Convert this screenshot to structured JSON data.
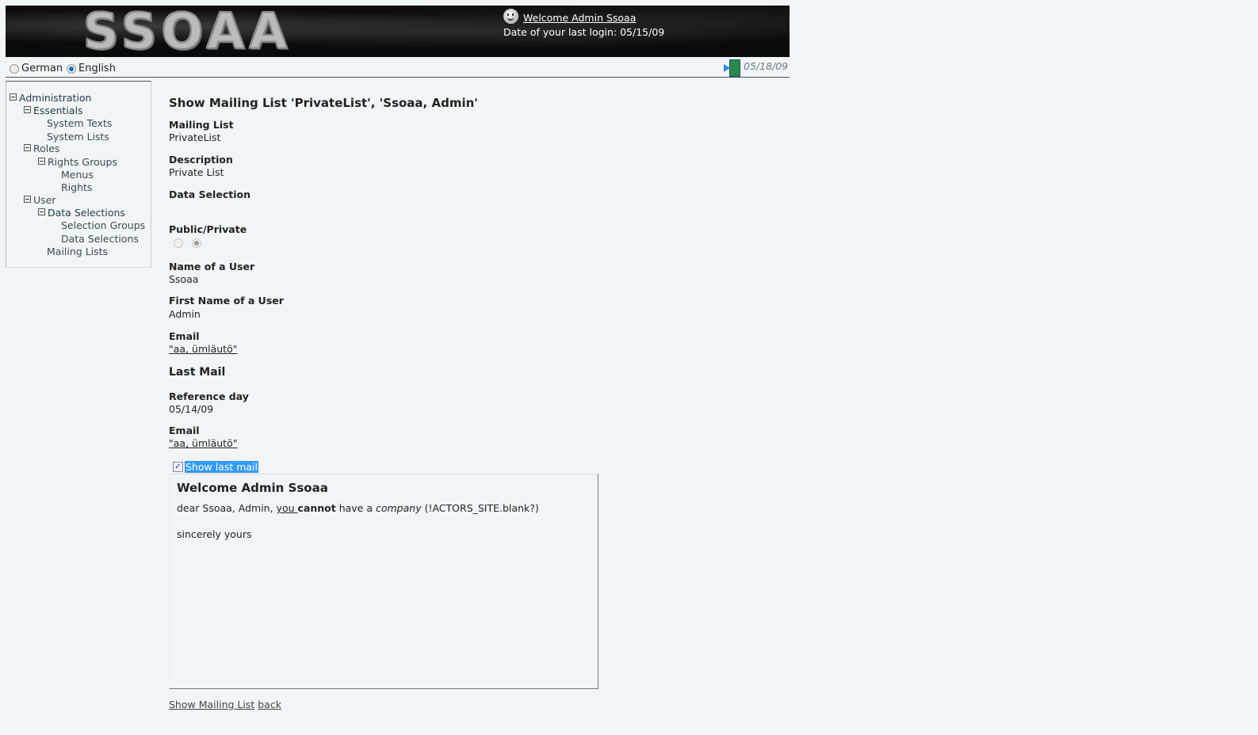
{
  "header": {
    "logo_text": "SSOAA",
    "welcome_link": "Welcome Admin Ssoaa",
    "last_login_text": "Date of your last login: 05/15/09"
  },
  "language": {
    "options": [
      {
        "label": "German",
        "selected": false
      },
      {
        "label": "English",
        "selected": true
      }
    ],
    "current_date": "05/18/09"
  },
  "sidebar": {
    "items": [
      {
        "label": "Administration",
        "expandable": true
      },
      {
        "label": "Essentials",
        "expandable": true
      },
      {
        "label": "System Texts",
        "expandable": false
      },
      {
        "label": "System Lists",
        "expandable": false
      },
      {
        "label": "Roles",
        "expandable": true
      },
      {
        "label": "Rights Groups",
        "expandable": true
      },
      {
        "label": "Menus",
        "expandable": false
      },
      {
        "label": "Rights",
        "expandable": false
      },
      {
        "label": "User",
        "expandable": true
      },
      {
        "label": "Data Selections",
        "expandable": true
      },
      {
        "label": "Selection Groups",
        "expandable": false
      },
      {
        "label": "Data Selections",
        "expandable": false
      },
      {
        "label": "Mailing Lists",
        "expandable": false
      }
    ]
  },
  "main": {
    "title": "Show Mailing List 'PrivateList', 'Ssoaa, Admin'",
    "fields": {
      "mailing_list_label": "Mailing List",
      "mailing_list_value": "PrivateList",
      "description_label": "Description",
      "description_value": "Private List",
      "data_selection_label": "Data Selection",
      "data_selection_value": "",
      "public_private_label": "Public/Private",
      "public_private_selected": "Private",
      "name_label": "Name of a User",
      "name_value": "Ssoaa",
      "first_name_label": "First Name of a User",
      "first_name_value": "Admin",
      "email_label": "Email",
      "email_value": "\"aa, ümläutö\""
    },
    "last_mail": {
      "section_title": "Last Mail",
      "reference_day_label": "Reference day",
      "reference_day_value": "05/14/09",
      "email_label": "Email",
      "email_value": "\"aa, ümläutö\"",
      "show_checkbox_label": "Show last mail",
      "show_checked": true
    },
    "mail_preview": {
      "heading": "Welcome Admin Ssoaa",
      "line1_a": "dear Ssoaa, Admin, ",
      "line1_you": "you ",
      "line1_cannot": "cannot",
      "line1_b": " have a ",
      "line1_company": "company",
      "line1_c": " (!ACTORS_SITE.blank?)",
      "closing": "sincerely yours"
    },
    "footer": {
      "show_link": "Show Mailing List",
      "back_link": "back"
    }
  }
}
